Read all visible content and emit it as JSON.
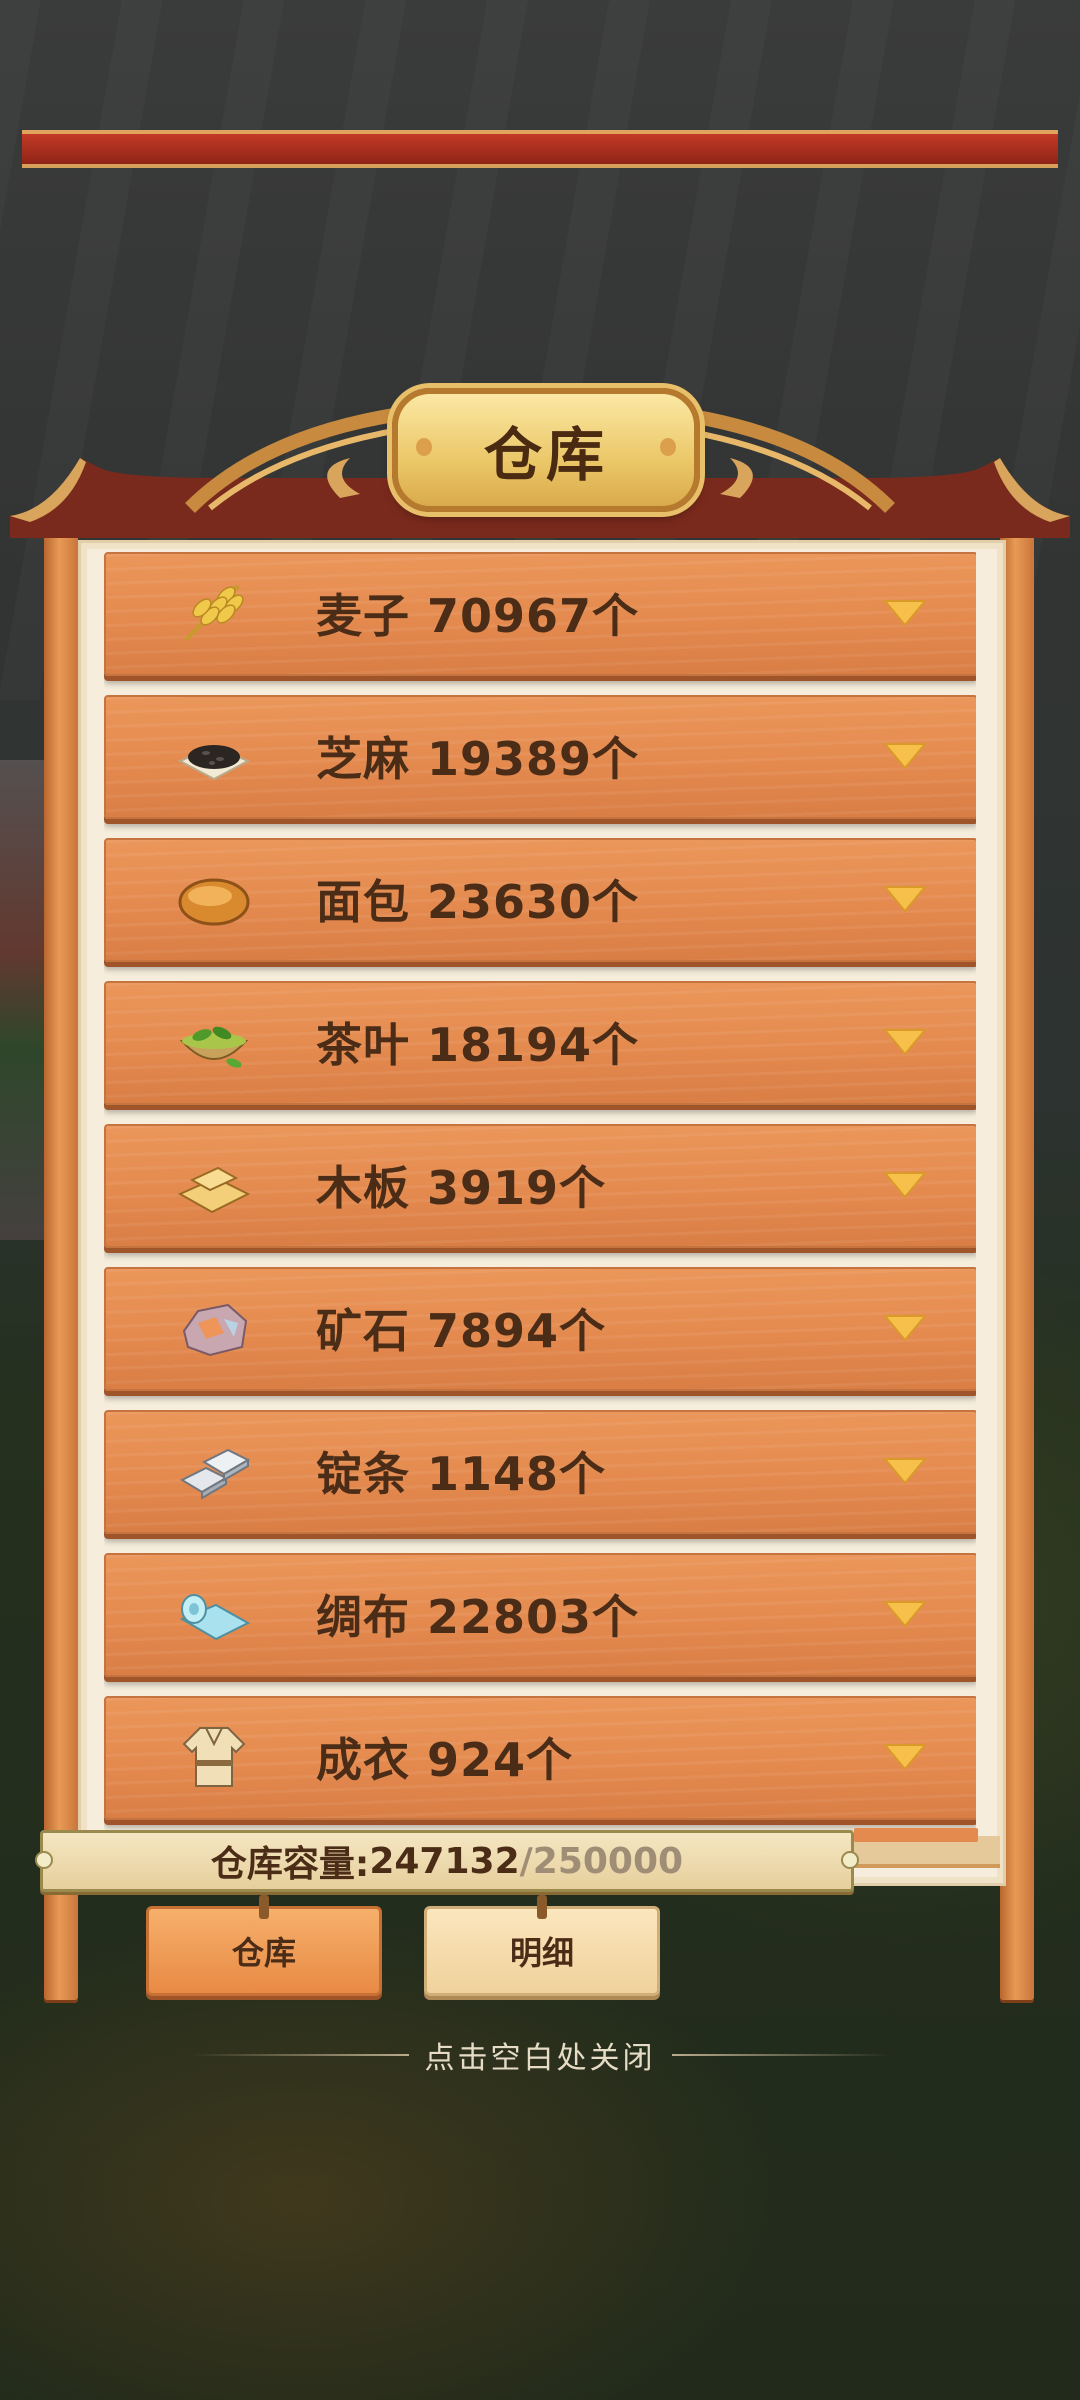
{
  "title": "仓库",
  "items": [
    {
      "label": "麦子 70967个",
      "icon": "wheat-icon"
    },
    {
      "label": "芝麻 19389个",
      "icon": "sesame-icon"
    },
    {
      "label": "面包 23630个",
      "icon": "bread-icon"
    },
    {
      "label": "茶叶 18194个",
      "icon": "tea-leaves-icon"
    },
    {
      "label": "木板 3919个",
      "icon": "wood-plank-icon"
    },
    {
      "label": "矿石 7894个",
      "icon": "ore-icon"
    },
    {
      "label": "锭条 1148个",
      "icon": "ingot-icon"
    },
    {
      "label": "绸布 22803个",
      "icon": "silk-cloth-icon"
    },
    {
      "label": "成衣 924个",
      "icon": "garment-icon"
    }
  ],
  "capacity": {
    "label": "仓库容量:",
    "used": "247132",
    "separator": "/",
    "max": "250000"
  },
  "tabs": {
    "storage": "仓库",
    "details": "明细"
  },
  "close_hint": "点击空白处关闭",
  "colors": {
    "item_bg": "#e48a4f",
    "text_brown": "#4a2c17",
    "chevron": "#f6c04a",
    "panel_bg": "#f6eddc"
  }
}
